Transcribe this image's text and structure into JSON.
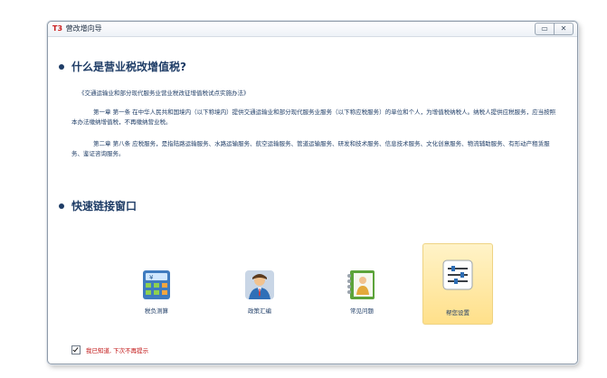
{
  "window": {
    "brand": "T3",
    "title": "营改增向导",
    "minimize_glyph": "▭",
    "close_glyph": "✕"
  },
  "section1": {
    "heading": "什么是营业税改增值税?",
    "subtitle": "《交通运输业和部分现代服务业营业税改征增值税试点实施办法》",
    "para1": "第一章 第一条 在中华人民共和国境内（以下称境内）提供交通运输业和部分现代服务业服务（以下称应税服务）的单位和个人，为增值税纳税人。纳税人提供应税服务，应当按照本办法缴纳增值税，不再缴纳营业税。",
    "para2": "第二章 第八条 应税服务，是指陆路运输服务、水路运输服务、航空运输服务、管道运输服务、研发和技术服务、信息技术服务、文化创意服务、物流辅助服务、有形动产租赁服务、鉴证咨询服务。"
  },
  "section2": {
    "heading": "快速链接窗口"
  },
  "quick_links": [
    {
      "label": "税负测算",
      "icon": "calculator-icon",
      "selected": false
    },
    {
      "label": "政策汇编",
      "icon": "person-book-icon",
      "selected": false
    },
    {
      "label": "常见问题",
      "icon": "notebook-person-icon",
      "selected": false
    },
    {
      "label": "帮您设置",
      "icon": "settings-sliders-icon",
      "selected": true
    }
  ],
  "footer": {
    "checkbox_checked": true,
    "label": "我已知道, 下次不再提示"
  },
  "colors": {
    "heading": "#1e3c66",
    "footer_text": "#c21717",
    "selected_bg": "#ffe08a"
  }
}
